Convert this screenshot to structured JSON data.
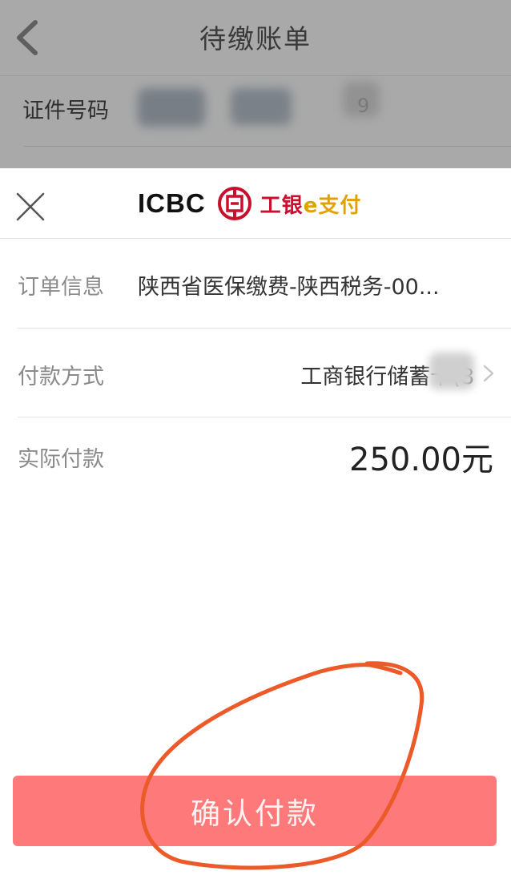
{
  "background_page": {
    "title": "待缴账单",
    "id_label": "证件号码",
    "id_masked_suffix": "9"
  },
  "sheet": {
    "brand_en": "ICBC",
    "brand_cn_main": "工银",
    "brand_cn_pay": "e支付",
    "order": {
      "label": "订单信息",
      "value": "陕西省医保缴费-陕西税务-00..."
    },
    "payment_method": {
      "label": "付款方式",
      "value": "工商银行储蓄卡(8"
    },
    "amount": {
      "label": "实际付款",
      "value": "250.00元"
    },
    "confirm_label": "确认付款"
  },
  "colors": {
    "confirm_button": "#fe7a7a",
    "brand_red": "#c8102e",
    "annotation_stroke": "#ec5a2a",
    "dim_overlay": "#a9a9a9"
  },
  "icons": [
    "back-chevron-icon",
    "close-icon",
    "icbc-logo-icon",
    "chevron-right-icon"
  ]
}
